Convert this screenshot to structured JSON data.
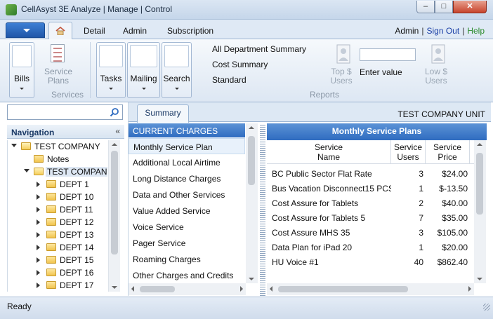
{
  "window": {
    "title": "CellAsyst 3E  Analyze | Manage | Control",
    "min": "–",
    "max": "□",
    "close": "✕"
  },
  "tabs": {
    "detail": "Detail",
    "admin": "Admin",
    "subscription": "Subscription"
  },
  "top_links": {
    "admin": "Admin",
    "sign_out": "Sign Out",
    "help": "Help",
    "separator": "|"
  },
  "ribbon": {
    "bills": "Bills",
    "service_plans": "Service Plans",
    "services_group": "Services",
    "tasks": "Tasks",
    "mailing": "Mailing",
    "search": "Search",
    "reports": [
      "All Department Summary",
      "Cost Summary",
      "Standard"
    ],
    "top_users": "Top $ Users",
    "enter_value": "Enter value",
    "low_users": "Low $ Users",
    "reports_group": "Reports"
  },
  "nav": {
    "search_placeholder": "",
    "title": "Navigation",
    "collapse": "«",
    "tree": [
      {
        "label": "TEST COMPANY",
        "level": 0,
        "expanded": true
      },
      {
        "label": "Notes",
        "level": 1,
        "expanded": null
      },
      {
        "label": "TEST COMPANY",
        "level": 1,
        "expanded": true,
        "selected": true
      },
      {
        "label": "DEPT 1",
        "level": 2,
        "expanded": false
      },
      {
        "label": "DEPT 10",
        "level": 2,
        "expanded": false
      },
      {
        "label": "DEPT 11",
        "level": 2,
        "expanded": false
      },
      {
        "label": "DEPT 12",
        "level": 2,
        "expanded": false
      },
      {
        "label": "DEPT 13",
        "level": 2,
        "expanded": false
      },
      {
        "label": "DEPT 14",
        "level": 2,
        "expanded": false
      },
      {
        "label": "DEPT 15",
        "level": 2,
        "expanded": false
      },
      {
        "label": "DEPT 16",
        "level": 2,
        "expanded": false
      },
      {
        "label": "DEPT 17",
        "level": 2,
        "expanded": false
      }
    ]
  },
  "content": {
    "tab_summary": "Summary",
    "company_unit": "TEST COMPANY UNIT",
    "charges_header": "CURRENT CHARGES",
    "charges": [
      "Monthly Service Plan",
      "Additional Local Airtime",
      "Long Distance Charges",
      "Data and Other Services",
      "Value Added Service",
      "Voice Service",
      "Pager Service",
      "Roaming Charges",
      "Other Charges and Credits"
    ],
    "selected_charge": 0,
    "plans_header": "Monthly Service Plans",
    "columns": {
      "name": "Service\nName",
      "users": "Service\nUsers",
      "price": "Service\nPrice"
    },
    "plans": [
      {
        "name": "BC Public Sector Flat Rate",
        "users": "3",
        "price": "$24.00"
      },
      {
        "name": "Bus Vacation Disconnect15 PCS",
        "users": "1",
        "price": "$-13.50"
      },
      {
        "name": "Cost Assure for Tablets",
        "users": "2",
        "price": "$40.00"
      },
      {
        "name": "Cost Assure for Tablets 5",
        "users": "7",
        "price": "$35.00"
      },
      {
        "name": "Cost Assure MHS 35",
        "users": "3",
        "price": "$105.00"
      },
      {
        "name": "Data Plan for iPad  20",
        "users": "1",
        "price": "$20.00"
      },
      {
        "name": "HU Voice #1",
        "users": "40",
        "price": "$862.40"
      }
    ]
  },
  "status": {
    "text": "Ready"
  },
  "colors": {
    "accent": "#2f6cc0",
    "link": "#1a3fa6",
    "help": "#2a8a2a"
  }
}
